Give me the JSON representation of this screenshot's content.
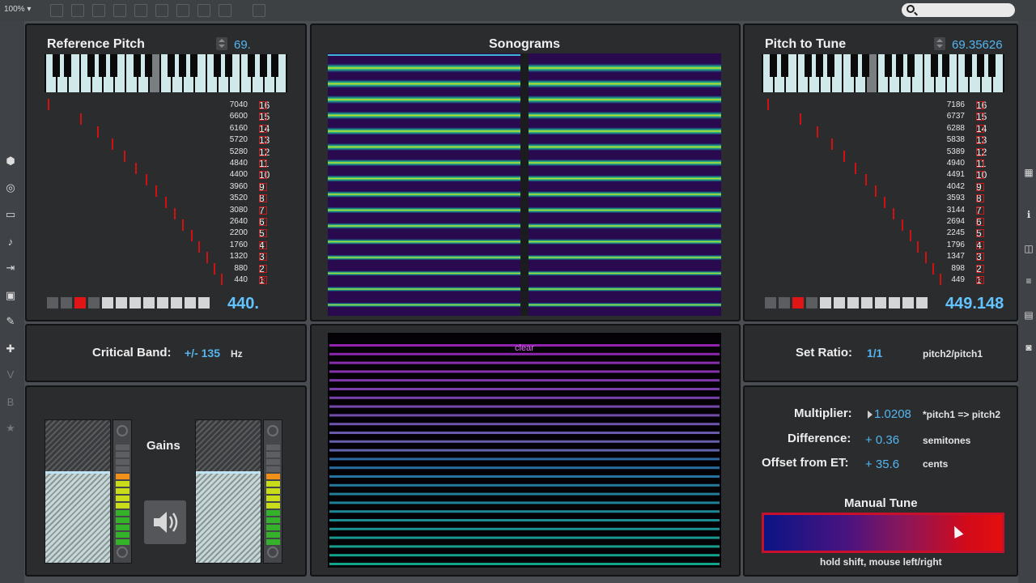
{
  "toolbar": {
    "zoom": "100%"
  },
  "reference": {
    "title": "Reference Pitch",
    "midi_note": "69.",
    "frequencies": [
      "7040",
      "6600",
      "6160",
      "5720",
      "5280",
      "4840",
      "4400",
      "3960",
      "3520",
      "3080",
      "2640",
      "2200",
      "1760",
      "1320",
      "880",
      "440"
    ],
    "harmonics": [
      "16",
      "15",
      "14",
      "13",
      "12",
      "11",
      "10",
      "9",
      "8",
      "7",
      "6",
      "5",
      "4",
      "3",
      "2",
      "1"
    ],
    "current_hz": "440."
  },
  "sonograms": {
    "title": "Sonograms",
    "clear_label": "clear"
  },
  "tune": {
    "title": "Pitch to Tune",
    "midi_note": "69.35626",
    "frequencies": [
      "7186",
      "6737",
      "6288",
      "5838",
      "5389",
      "4940",
      "4491",
      "4042",
      "3593",
      "3144",
      "2694",
      "2245",
      "1796",
      "1347",
      "898",
      "449"
    ],
    "harmonics": [
      "16",
      "15",
      "14",
      "13",
      "12",
      "11",
      "10",
      "9",
      "8",
      "7",
      "6",
      "5",
      "4",
      "3",
      "2",
      "1"
    ],
    "current_hz": "449.148"
  },
  "critical_band": {
    "label": "Critical Band:",
    "value": "+/- 135",
    "unit": "Hz"
  },
  "gains": {
    "label": "Gains",
    "left_level": 0.64,
    "right_level": 0.64
  },
  "ratio": {
    "label": "Set Ratio:",
    "value": "1/1",
    "formula": "pitch2/pitch1"
  },
  "analysis": {
    "multiplier_label": "Multiplier:",
    "multiplier_value": "1.0208",
    "multiplier_note": "*pitch1 => pitch2",
    "difference_label": "Difference:",
    "difference_value": "+ 0.36",
    "difference_unit": "semitones",
    "offset_label": "Offset from ET:",
    "offset_value": "+ 35.6",
    "offset_unit": "cents"
  },
  "manual_tune": {
    "title": "Manual Tune",
    "hint": "hold shift, mouse left/right"
  },
  "colors": {
    "accent_blue": "#53b6f0",
    "harmonic_red": "#d21212",
    "panel_bg": "#2b2c2e"
  }
}
